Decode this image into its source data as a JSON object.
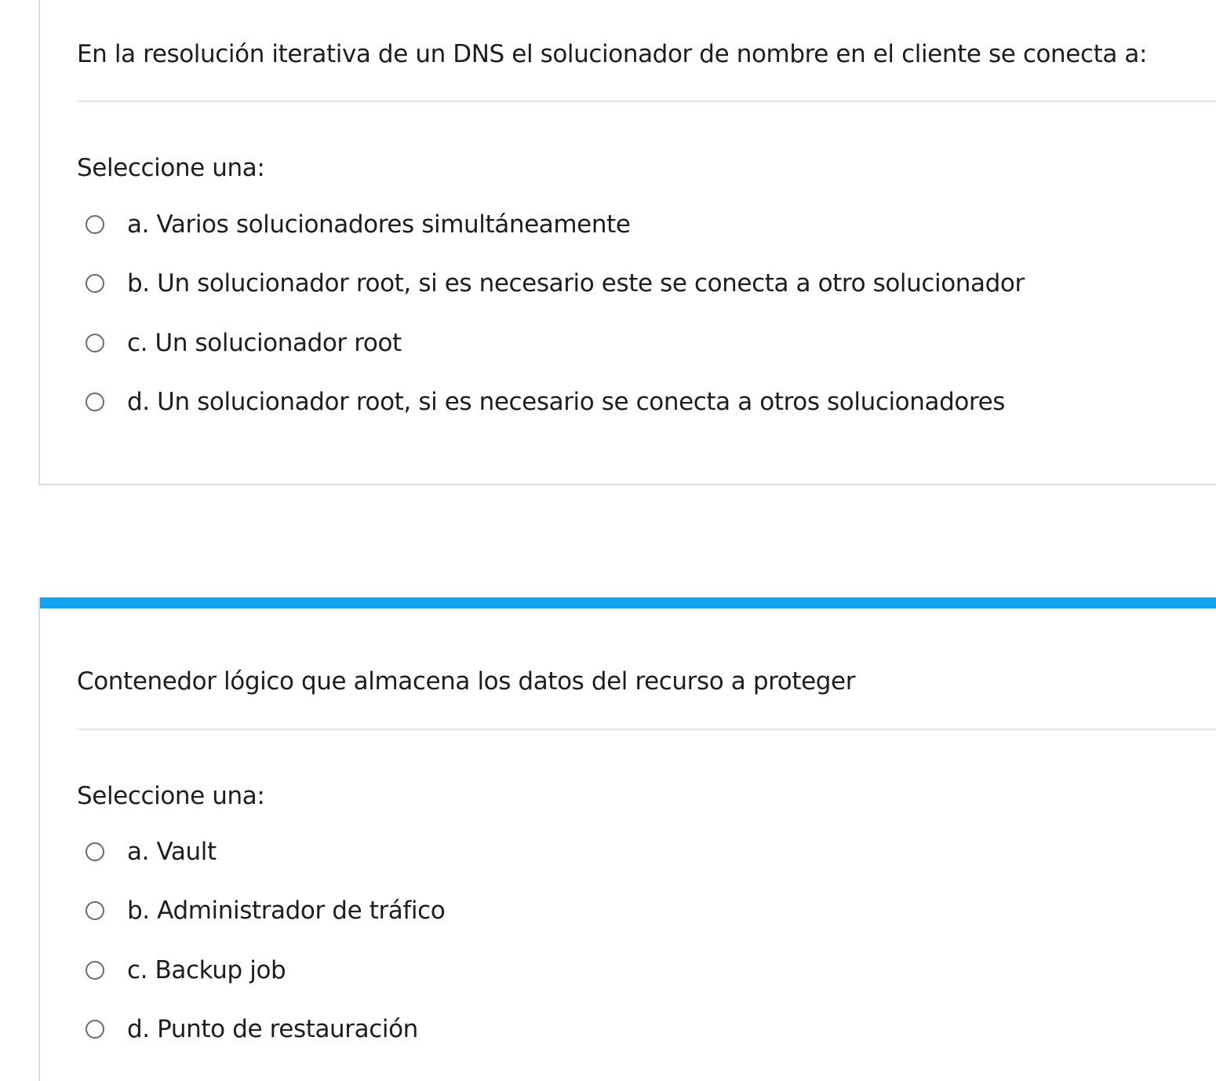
{
  "colors": {
    "accent": "#12a4ee",
    "border": "#dcdcdc",
    "divider": "#e6e6e6",
    "text": "#1d1d1d",
    "radio_border": "#6b6b6b"
  },
  "questions": [
    {
      "text": "En la resolución iterativa de un DNS el solucionador de nombre en el cliente se conecta a:",
      "prompt": "Seleccione una:",
      "options": [
        "a. Varios solucionadores simultáneamente",
        "b. Un solucionador root, si es necesario este se conecta a otro solucionador",
        "c. Un solucionador root",
        "d. Un solucionador root, si es necesario se conecta a otros solucionadores"
      ]
    },
    {
      "text": "Contenedor lógico que almacena los datos del recurso a proteger",
      "prompt": "Seleccione una:",
      "options": [
        "a. Vault",
        "b. Administrador de tráfico",
        "c. Backup job",
        "d. Punto de restauración"
      ]
    }
  ]
}
